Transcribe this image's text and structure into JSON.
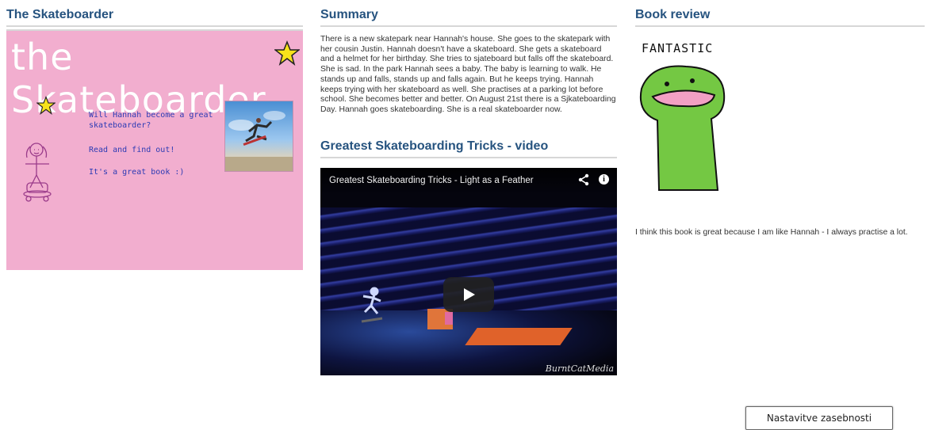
{
  "columns": {
    "book": {
      "heading": "The Skateboarder"
    },
    "summary": {
      "heading": "Summary",
      "text": "There is a new skatepark near Hannah's house. She goes to the skatepark with her cousin Justin. Hannah doesn't have a skateboard. She gets a skateboard and a helmet for her birthday. She tries to sjateboard but falls off the skateboard. She is sad. In the park Hannah sees a baby. The baby is learning to walk. He stands up and falls, stands up and falls again. But he keeps trying. Hannah keeps trying with her skateboard as well. She practises at a parking lot before school. She becomes better and better. On August 21st there is a Sjkateboarding Day. Hannah goes skateboarding. She is a real skateboarder now."
    },
    "review": {
      "heading": "Book review",
      "drawing_caption": "FANTASTIC",
      "text": "I think this book is great because I am like Hannah - I always practise a lot."
    }
  },
  "poster": {
    "title": "the Skateboarder",
    "lines": [
      "Will Hannah become a great skateboarder?",
      "Read and find out!",
      "It's a great book :)"
    ],
    "background_color": "#f2aecf",
    "star_color": "#f7e21b"
  },
  "video": {
    "section_heading": "Greatest Skateboarding Tricks - video",
    "title": "Greatest Skateboarding Tricks - Light as a Feather",
    "watermark": "BurntCatMedia",
    "icons": [
      "share-icon",
      "info-icon",
      "play-icon"
    ]
  },
  "footer": {
    "privacy_button": "Nastavitve zasebnosti"
  }
}
